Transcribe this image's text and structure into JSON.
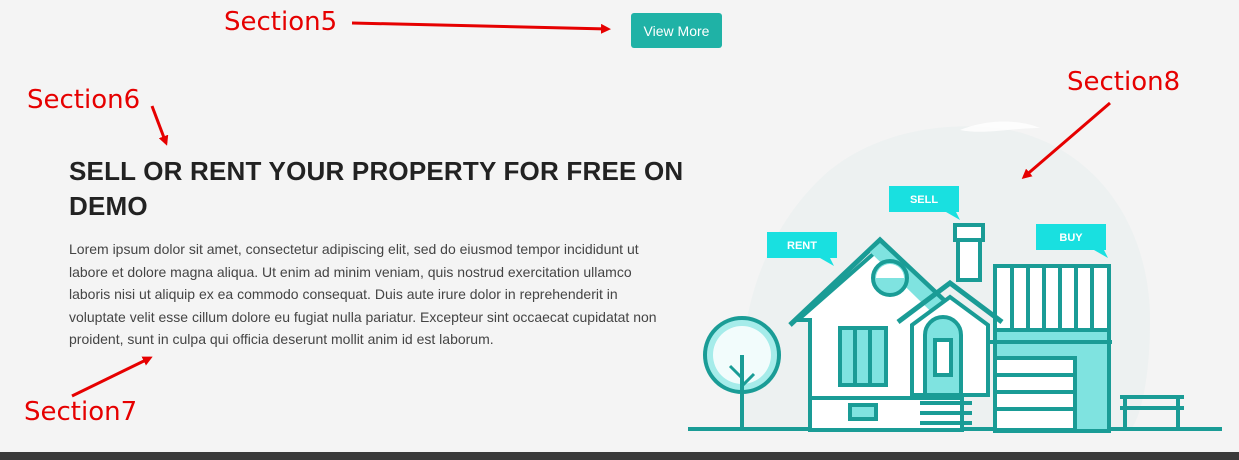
{
  "annotations": {
    "section5": "Section5",
    "section6": "Section6",
    "section7": "Section7",
    "section8": "Section8"
  },
  "cta": {
    "view_more_label": "View More"
  },
  "content": {
    "headline": "SELL OR RENT YOUR PROPERTY FOR FREE ON DEMO",
    "body": "Lorem ipsum dolor sit amet, consectetur adipiscing elit, sed do eiusmod tempor incididunt ut labore et dolore magna aliqua. Ut enim ad minim veniam, quis nostrud exercitation ullamco laboris nisi ut aliquip ex ea commodo consequat. Duis aute irure dolor in reprehenderit in voluptate velit esse cillum dolore eu fugiat nulla pariatur. Excepteur sint occaecat cupidatat non proident, sunt in culpa qui officia deserunt mollit anim id est laborum."
  },
  "illustration": {
    "sign_rent": "RENT",
    "sign_sell": "SELL",
    "sign_buy": "BUY"
  },
  "colors": {
    "accent": "#1fb2a6",
    "house_stroke": "#1a9c96",
    "sign_fill": "#19e0e0",
    "annotation": "#e60000"
  }
}
